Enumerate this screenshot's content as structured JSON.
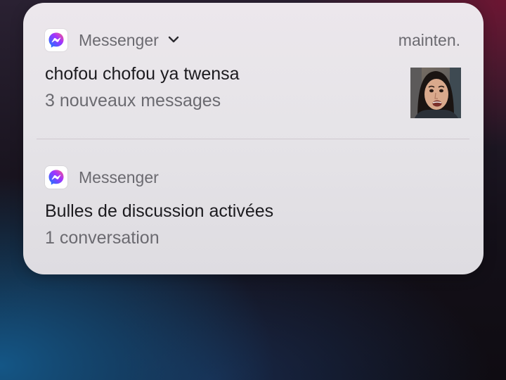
{
  "notifications": [
    {
      "app_icon": "messenger-icon",
      "app_name": "Messenger",
      "expand_icon": "chevron-down-icon",
      "time": "mainten.",
      "title": "chofou chofou ya twensa",
      "subtitle": "3 nouveaux messages",
      "thumbnail": "contact-photo"
    },
    {
      "app_icon": "messenger-icon",
      "app_name": "Messenger",
      "title": "Bulles de discussion activées",
      "subtitle": "1 conversation"
    }
  ],
  "colors": {
    "messenger_gradient_start": "#0a7cff",
    "messenger_gradient_mid": "#a033ff",
    "messenger_gradient_end": "#ff5c87"
  }
}
